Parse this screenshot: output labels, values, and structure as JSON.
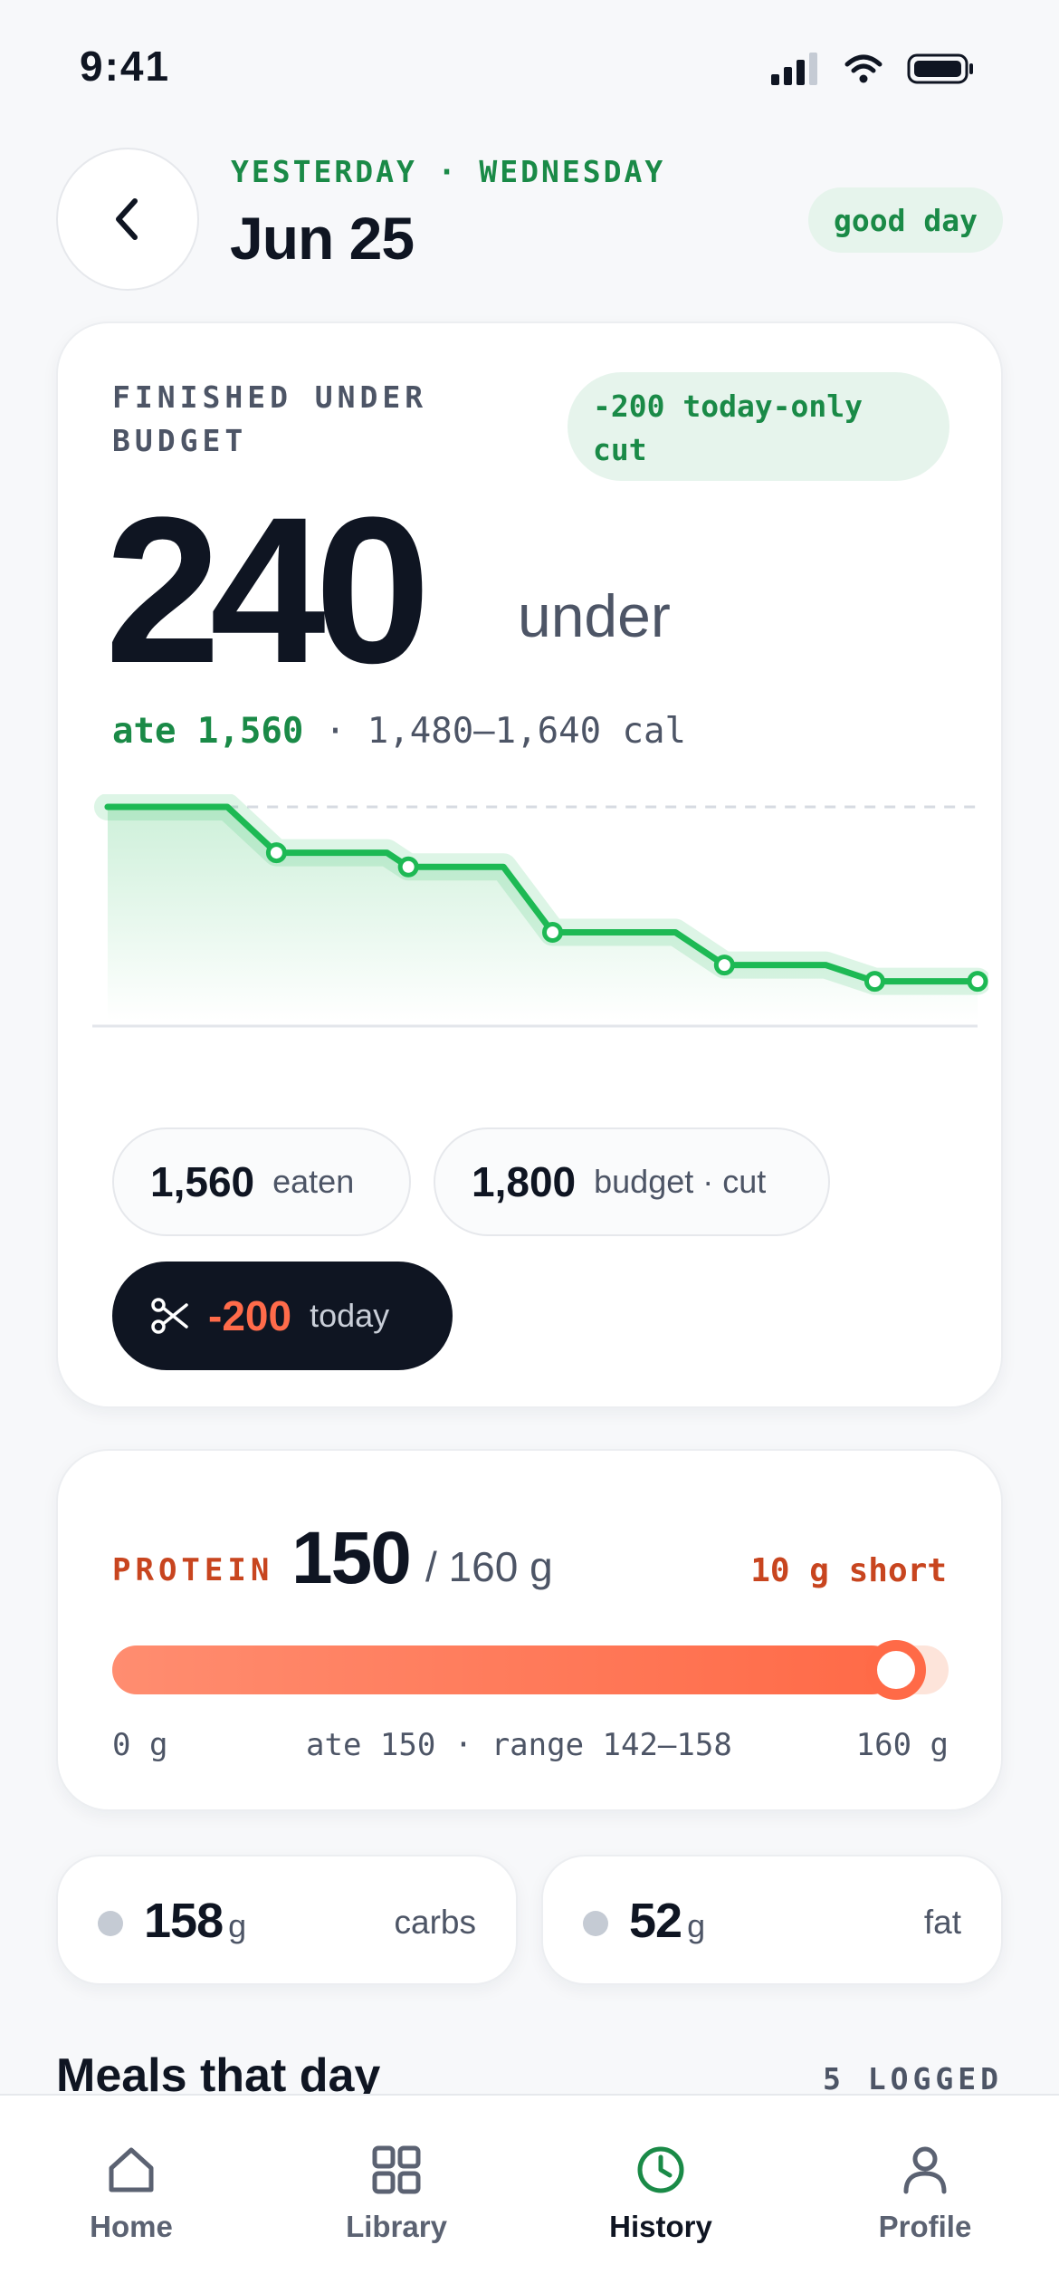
{
  "status_bar": {
    "time": "9:41"
  },
  "header": {
    "eyebrow": "YESTERDAY · WEDNESDAY",
    "date": "Jun 25",
    "badge": "good day"
  },
  "budget_card": {
    "kicker": "FINISHED UNDER BUDGET",
    "cut_pill": "-200 today-only cut",
    "big_value": "240",
    "big_unit": "under",
    "ate_label": "ate 1,560",
    "range_text": " · 1,480–1,640 cal",
    "chips": {
      "eaten_value": "1,560",
      "eaten_label": "eaten",
      "budget_value": "1,800",
      "budget_label": "budget · cut",
      "cut_value": "-200",
      "cut_label": "today"
    },
    "accent_color": "#1db954"
  },
  "chart_data": {
    "type": "line",
    "title": "",
    "xlabel": "",
    "ylabel": "",
    "series": [
      {
        "values": [
          1800,
          1800,
          1590,
          1590,
          1525,
          1525,
          1225,
          1225,
          1075,
          1075,
          1000,
          1000
        ]
      }
    ],
    "markers_at": [
      2,
      4,
      6,
      8,
      10,
      11
    ],
    "reference_line": 1800,
    "ylim": [
      820,
      1800
    ],
    "grid": false
  },
  "protein": {
    "label": "PROTEIN",
    "value": "150",
    "target": "/ 160 g",
    "status": "10 g short",
    "progress": 0.9375,
    "scale_min": "0 g",
    "scale_mid": "ate 150 · range 142–158",
    "scale_max": "160 g",
    "color": "#ff6a47"
  },
  "macros": {
    "carbs_value": "158",
    "carbs_unit": "g",
    "carbs_label": "carbs",
    "fat_value": "52",
    "fat_unit": "g",
    "fat_label": "fat"
  },
  "meals": {
    "title": "Meals that day",
    "count": "5 LOGGED"
  },
  "tabs": [
    {
      "label": "Home",
      "icon": "home-icon"
    },
    {
      "label": "Library",
      "icon": "grid-icon"
    },
    {
      "label": "History",
      "icon": "clock-icon",
      "active": true
    },
    {
      "label": "Profile",
      "icon": "person-icon"
    }
  ]
}
